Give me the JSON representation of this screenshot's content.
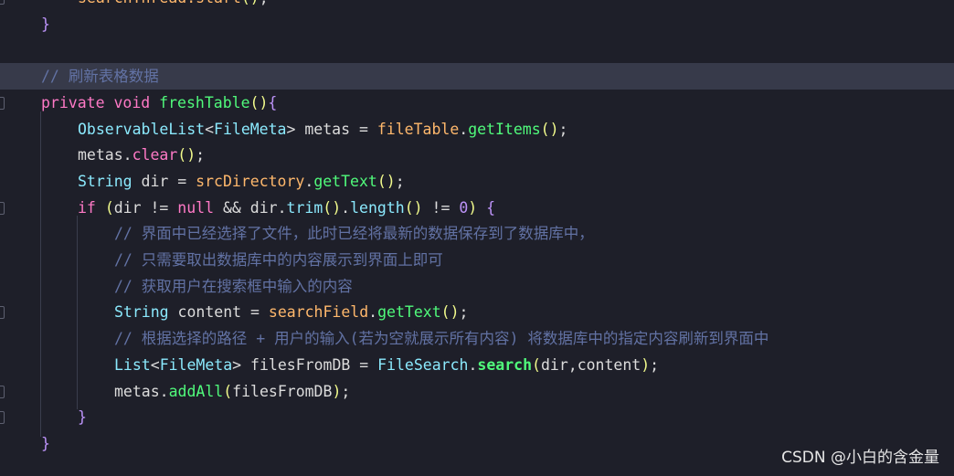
{
  "colors": {
    "background": "#1e1f29",
    "current_line": "#373a4a",
    "keyword": "#ff79c6",
    "function": "#50fa7b",
    "field": "#ffb86c",
    "type": "#8be9fd",
    "comment": "#6272a4",
    "paren": "#f1fa8c",
    "brace": "#bd93f9",
    "text": "#dcdcdc"
  },
  "icons": {
    "intention": "lightbulb-icon",
    "fold": "fold-marker-icon"
  },
  "editor": {
    "lines": [
      {
        "indent": 2,
        "tokens": [
          {
            "t": "searchThread.start",
            "c": "field"
          },
          {
            "t": "()",
            "c": "paren"
          },
          {
            "t": ";",
            "c": "text"
          }
        ]
      },
      {
        "indent": 1,
        "tokens": [
          {
            "t": "}",
            "c": "brace"
          }
        ]
      },
      {
        "indent": 0,
        "tokens": []
      },
      {
        "indent": 1,
        "highlight": true,
        "bulb": true,
        "tokens": [
          {
            "t": "// 刷新表格数据",
            "c": "comment"
          }
        ]
      },
      {
        "indent": 1,
        "tokens": [
          {
            "t": "private",
            "c": "keyword"
          },
          {
            "t": " ",
            "c": "text"
          },
          {
            "t": "void",
            "c": "keyword"
          },
          {
            "t": " ",
            "c": "text"
          },
          {
            "t": "freshTable",
            "c": "function"
          },
          {
            "t": "()",
            "c": "paren"
          },
          {
            "t": "{",
            "c": "brace"
          }
        ]
      },
      {
        "indent": 2,
        "tokens": [
          {
            "t": "ObservableList",
            "c": "type"
          },
          {
            "t": "<",
            "c": "text"
          },
          {
            "t": "FileMeta",
            "c": "type"
          },
          {
            "t": "> metas = ",
            "c": "text"
          },
          {
            "t": "fileTable",
            "c": "field"
          },
          {
            "t": ".",
            "c": "text"
          },
          {
            "t": "getItems",
            "c": "function"
          },
          {
            "t": "()",
            "c": "paren"
          },
          {
            "t": ";",
            "c": "text"
          }
        ]
      },
      {
        "indent": 2,
        "tokens": [
          {
            "t": "metas.",
            "c": "text"
          },
          {
            "t": "clear",
            "c": "keyword"
          },
          {
            "t": "()",
            "c": "paren"
          },
          {
            "t": ";",
            "c": "text"
          }
        ]
      },
      {
        "indent": 2,
        "tokens": [
          {
            "t": "String",
            "c": "type"
          },
          {
            "t": " dir = ",
            "c": "text"
          },
          {
            "t": "srcDirectory",
            "c": "field"
          },
          {
            "t": ".",
            "c": "text"
          },
          {
            "t": "getText",
            "c": "function"
          },
          {
            "t": "()",
            "c": "paren"
          },
          {
            "t": ";",
            "c": "text"
          }
        ]
      },
      {
        "indent": 2,
        "tokens": [
          {
            "t": "if",
            "c": "keyword"
          },
          {
            "t": " ",
            "c": "text"
          },
          {
            "t": "(",
            "c": "paren"
          },
          {
            "t": "dir != ",
            "c": "text"
          },
          {
            "t": "null",
            "c": "keyword"
          },
          {
            "t": " && dir.",
            "c": "text"
          },
          {
            "t": "trim",
            "c": "type"
          },
          {
            "t": "()",
            "c": "paren"
          },
          {
            "t": ".",
            "c": "text"
          },
          {
            "t": "length",
            "c": "type"
          },
          {
            "t": "()",
            "c": "paren"
          },
          {
            "t": " != ",
            "c": "text"
          },
          {
            "t": "0",
            "c": "brace"
          },
          {
            "t": ")",
            "c": "paren"
          },
          {
            "t": " ",
            "c": "text"
          },
          {
            "t": "{",
            "c": "brace"
          }
        ]
      },
      {
        "indent": 3,
        "tokens": [
          {
            "t": "// 界面中已经选择了文件，此时已经将最新的数据保存到了数据库中，",
            "c": "comment"
          }
        ]
      },
      {
        "indent": 3,
        "tokens": [
          {
            "t": "// 只需要取出数据库中的内容展示到界面上即可",
            "c": "comment"
          }
        ]
      },
      {
        "indent": 3,
        "tokens": [
          {
            "t": "// 获取用户在搜索框中输入的内容",
            "c": "comment"
          }
        ]
      },
      {
        "indent": 3,
        "tokens": [
          {
            "t": "String",
            "c": "type"
          },
          {
            "t": " content = ",
            "c": "text"
          },
          {
            "t": "searchField",
            "c": "field"
          },
          {
            "t": ".",
            "c": "text"
          },
          {
            "t": "getText",
            "c": "function"
          },
          {
            "t": "()",
            "c": "paren"
          },
          {
            "t": ";",
            "c": "text"
          }
        ]
      },
      {
        "indent": 3,
        "tokens": [
          {
            "t": "// 根据选择的路径 + 用户的输入(若为空就展示所有内容) 将数据库中的指定内容刷新到界面中",
            "c": "comment"
          }
        ]
      },
      {
        "indent": 3,
        "tokens": [
          {
            "t": "List",
            "c": "type"
          },
          {
            "t": "<",
            "c": "text"
          },
          {
            "t": "FileMeta",
            "c": "type"
          },
          {
            "t": "> filesFromDB = ",
            "c": "text"
          },
          {
            "t": "FileSearch",
            "c": "type"
          },
          {
            "t": ".",
            "c": "text"
          },
          {
            "t": "search",
            "c": "function",
            "bold": true
          },
          {
            "t": "(",
            "c": "paren"
          },
          {
            "t": "dir,content",
            "c": "text"
          },
          {
            "t": ")",
            "c": "paren"
          },
          {
            "t": ";",
            "c": "text"
          }
        ]
      },
      {
        "indent": 3,
        "tokens": [
          {
            "t": "metas.",
            "c": "text"
          },
          {
            "t": "addAll",
            "c": "function"
          },
          {
            "t": "(",
            "c": "paren"
          },
          {
            "t": "filesFromDB",
            "c": "text"
          },
          {
            "t": ")",
            "c": "paren"
          },
          {
            "t": ";",
            "c": "text"
          }
        ]
      },
      {
        "indent": 2,
        "tokens": [
          {
            "t": "}",
            "c": "brace"
          }
        ]
      },
      {
        "indent": 1,
        "tokens": [
          {
            "t": "}",
            "c": "brace"
          }
        ]
      }
    ]
  },
  "watermark": "CSDN @小白的含金量"
}
